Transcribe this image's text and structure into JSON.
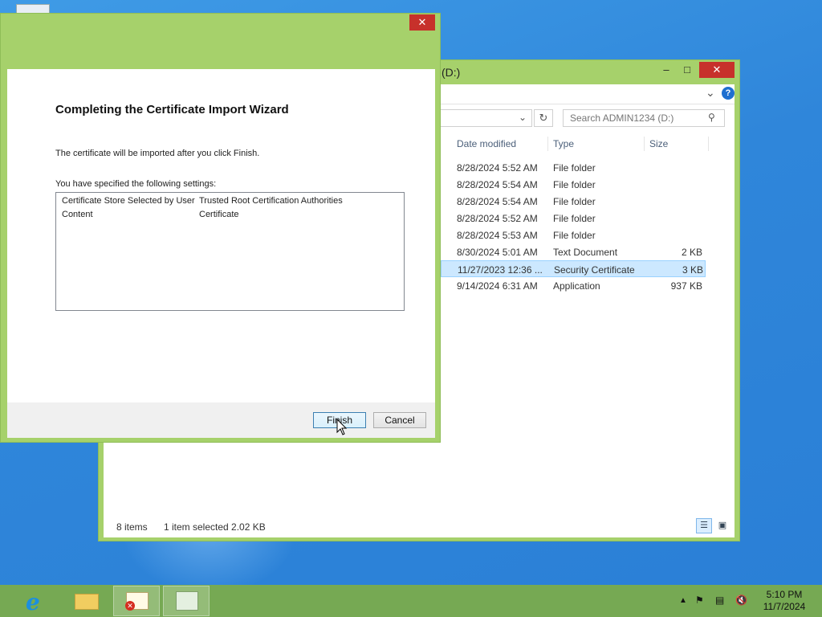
{
  "explorer": {
    "title": "(D:)",
    "search_placeholder": "Search ADMIN1234 (D:)",
    "columns": {
      "date": "Date modified",
      "type": "Type",
      "size": "Size"
    },
    "rows": [
      {
        "date": "8/28/2024 5:52 AM",
        "type": "File folder",
        "size": ""
      },
      {
        "date": "8/28/2024 5:54 AM",
        "type": "File folder",
        "size": ""
      },
      {
        "date": "8/28/2024 5:54 AM",
        "type": "File folder",
        "size": ""
      },
      {
        "date": "8/28/2024 5:52 AM",
        "type": "File folder",
        "size": ""
      },
      {
        "date": "8/28/2024 5:53 AM",
        "type": "File folder",
        "size": ""
      },
      {
        "date": "8/30/2024 5:01 AM",
        "type": "Text Document",
        "size": "2 KB"
      },
      {
        "date": "11/27/2023 12:36 ...",
        "type": "Security Certificate",
        "size": "3 KB",
        "selected": true
      },
      {
        "date": "9/14/2024 6:31 AM",
        "type": "Application",
        "size": "937 KB"
      }
    ],
    "status": {
      "items": "8 items",
      "selected": "1 item selected  2.02 KB"
    }
  },
  "wizard": {
    "title": "Completing the Certificate Import Wizard",
    "description": "The certificate will be imported after you click Finish.",
    "specified_label": "You have specified the following settings:",
    "settings": [
      {
        "key": "Certificate Store Selected by User",
        "value": "Trusted Root Certification Authorities"
      },
      {
        "key": "Content",
        "value": "Certificate"
      }
    ],
    "finish_label": "Finish",
    "cancel_label": "Cancel"
  },
  "taskbar": {
    "time": "5:10 PM",
    "date": "11/7/2024"
  },
  "icons": {
    "ie": "internet-explorer-icon",
    "folder": "file-explorer-icon",
    "cert": "certificate-icon",
    "wizard": "import-wizard-icon"
  },
  "colors": {
    "window_frame": "#a6d16b",
    "taskbar": "#76a953",
    "close_button": "#c7312b",
    "selection": "#cce8ff",
    "desktop": "#2f86da"
  }
}
